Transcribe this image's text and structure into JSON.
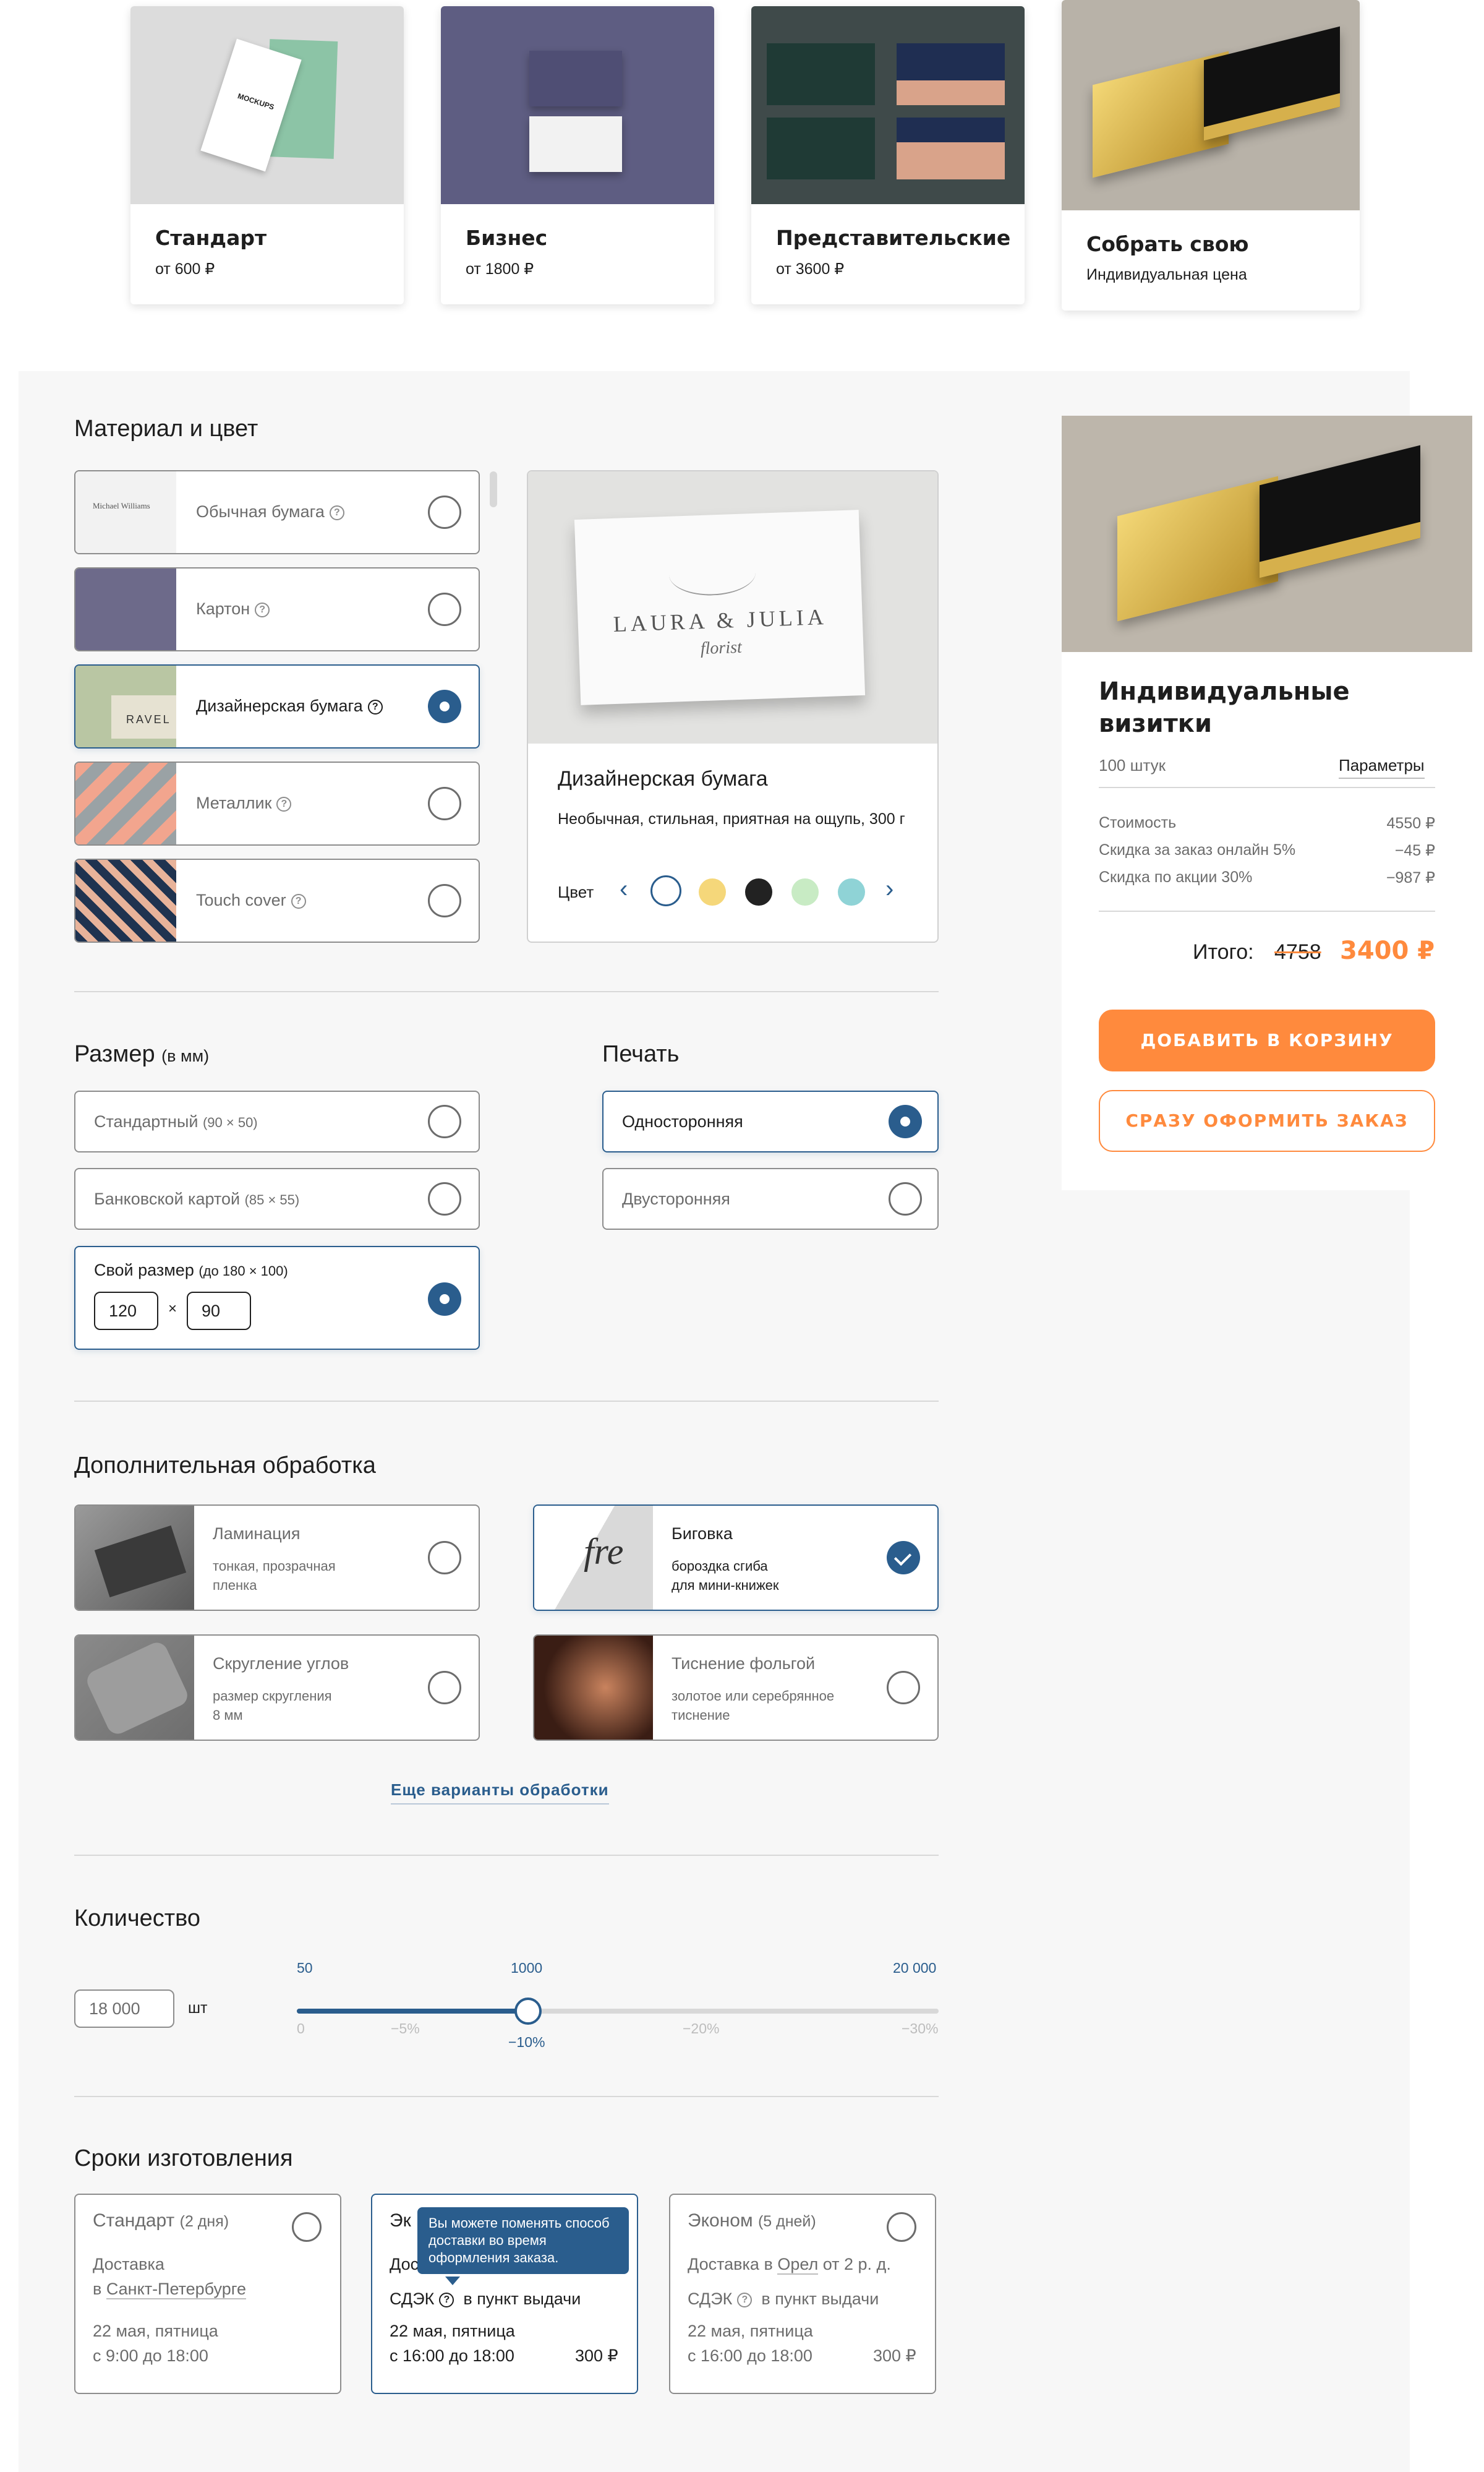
{
  "top_cards": [
    {
      "title": "Стандарт",
      "price": "от 600 ₽"
    },
    {
      "title": "Бизнес",
      "price": "от 1800 ₽"
    },
    {
      "title": "Представительские",
      "price": "от 3600 ₽"
    },
    {
      "title": "Собрать свою",
      "price": "Индивидуальная цена"
    }
  ],
  "material": {
    "heading": "Материал и цвет",
    "options": [
      {
        "label": "Обычная бумага",
        "thumb_text": "Michael Williams"
      },
      {
        "label": "Картон"
      },
      {
        "label": "Дизайнерская бумага",
        "thumb_text": "RAVEL"
      },
      {
        "label": "Металлик"
      },
      {
        "label": "Touch cover"
      }
    ],
    "preview": {
      "brand_line1": "LAURA & JULIA",
      "brand_line2": "florist",
      "title": "Дизайнерская бумага",
      "desc": "Необычная, стильная, приятная на ощупь, 300 г",
      "color_label": "Цвет",
      "prev_arrow": "‹",
      "next_arrow": "›",
      "swatches": [
        "#ffffff",
        "#f5d77a",
        "#222222",
        "#c8ebc4",
        "#8fd3d6"
      ]
    }
  },
  "size": {
    "heading": "Размер",
    "heading_note": "(в мм)",
    "options": [
      {
        "label": "Стандартный",
        "note": "(90 × 50)"
      },
      {
        "label": "Банковской картой",
        "note": "(85 × 55)"
      },
      {
        "label": "Свой размер",
        "note": "(до 180 × 100)"
      }
    ],
    "width": "120",
    "times": "×",
    "height": "90"
  },
  "print": {
    "heading": "Печать",
    "options": [
      "Односторонняя",
      "Двусторонняя"
    ]
  },
  "finishing": {
    "heading": "Дополнительная обработка",
    "options": [
      {
        "title": "Ламинация",
        "sub1": "тонкая, прозрачная",
        "sub2": "пленка"
      },
      {
        "title": "Биговка",
        "sub1": "бороздка сгиба",
        "sub2": "для мини-книжек"
      },
      {
        "title": "Скругление углов",
        "sub1": "размер скругления",
        "sub2": "8 мм"
      },
      {
        "title": "Тиснение фольгой",
        "sub1": "золотое или серебрянное",
        "sub2": "тиснение"
      }
    ],
    "more_link": "Еще варианты обработки"
  },
  "quantity": {
    "heading": "Количество",
    "value": "18 000",
    "unit": "шт",
    "top_ticks": [
      "50",
      "1000",
      "20 000"
    ],
    "bottom_ticks": [
      "0",
      "−5%",
      "−10%",
      "−20%",
      "−30%"
    ],
    "slider_fraction": 0.36
  },
  "terms": {
    "heading": "Сроки изготовления",
    "cards": [
      {
        "title": "Стандарт",
        "note": "(2 дня)",
        "line1a": "Доставка",
        "line2a": "в",
        "line2link": "Санкт-Петербурге",
        "date": "22 мая, пятница",
        "time": "с 9:00 до 18:00"
      },
      {
        "title": "Эк",
        "line1a": "Дос",
        "service": "СДЭК",
        "pickup": "в пункт выдачи",
        "date": "22 мая, пятница",
        "time": "с 16:00 до 18:00",
        "price": "300 ₽"
      },
      {
        "title": "Эконом",
        "note": "(5 дней)",
        "line1a": "Доставка в",
        "line1link": "Орел",
        "line1b": "от 2 р. д.",
        "service": "СДЭК",
        "pickup": "в пункт выдачи",
        "date": "22 мая, пятница",
        "time": "с 16:00 до 18:00",
        "price": "300 ₽"
      }
    ],
    "tooltip": "Вы можете поменять способ доставки во время оформления заказа."
  },
  "summary": {
    "title_line1": "Индивидуальные",
    "title_line2": "визитки",
    "count": "100 штук",
    "params_link": "Параметры",
    "rows": [
      {
        "label": "Стоимость",
        "value": "4550 ₽"
      },
      {
        "label": "Скидка за заказ онлайн 5%",
        "value": "−45 ₽"
      },
      {
        "label": "Скидка по акции 30%",
        "value": "−987 ₽"
      }
    ],
    "total_label": "Итого:",
    "old_total": "4758",
    "new_total": "3400 ₽",
    "add_to_cart": "ДОБАВИТЬ В КОРЗИНУ",
    "checkout": "СРАЗУ ОФОРМИТЬ ЗАКАЗ"
  },
  "colors": {
    "accent": "#2a5d8d",
    "orange": "#ff8a3d"
  }
}
